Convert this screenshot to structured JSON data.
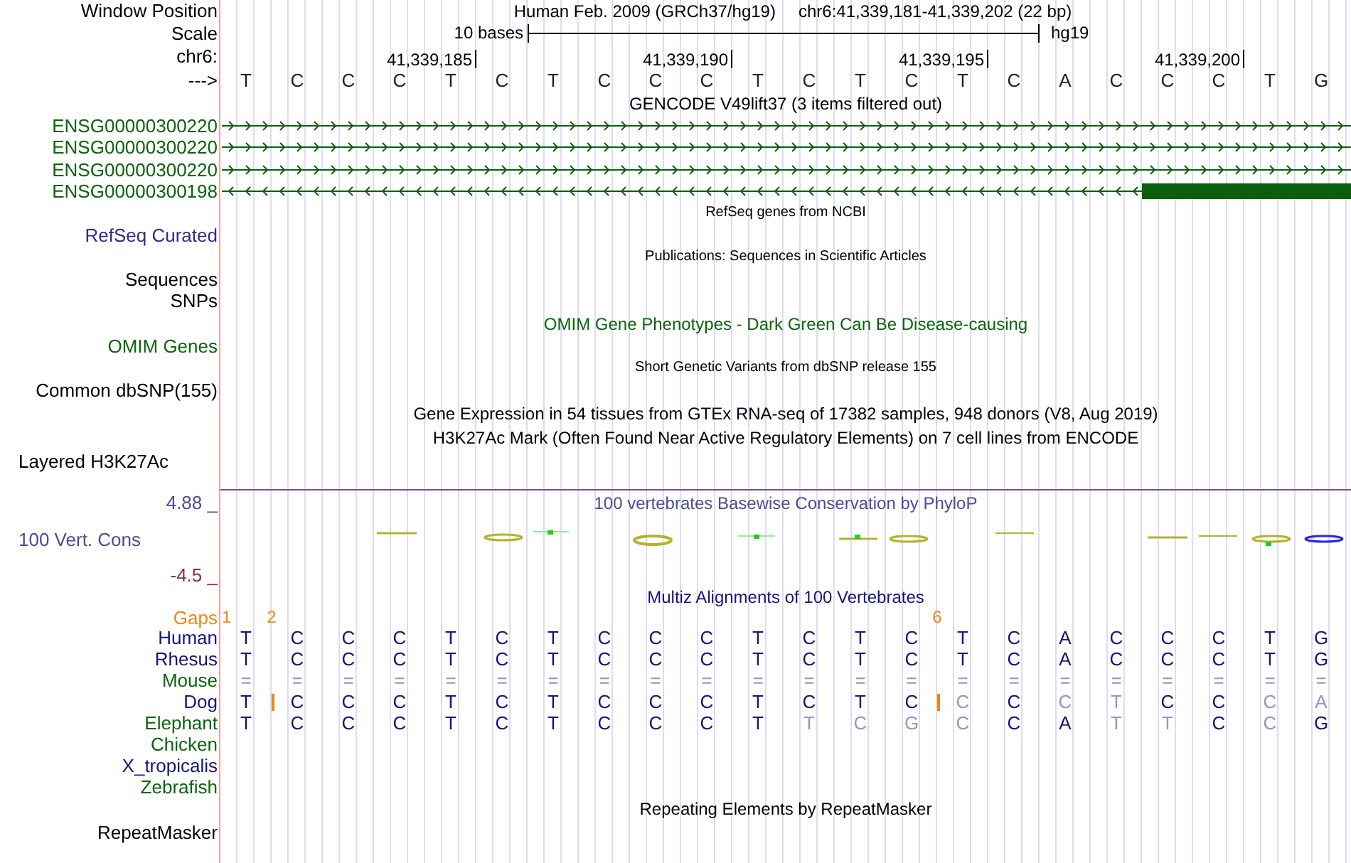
{
  "header": {
    "label": "Window Position",
    "assembly": "Human Feb. 2009 (GRCh37/hg19)",
    "range": "chr6:41,339,181-41,339,202 (22 bp)"
  },
  "scale": {
    "label": "Scale",
    "length": "10 bases",
    "assembly": "hg19"
  },
  "ruler_label": "chr6:",
  "strand_label": "--->",
  "sequence": [
    {
      "base": "T",
      "gap_mark": "1"
    },
    {
      "base": "C",
      "gap_mark": "2"
    },
    {
      "base": "C"
    },
    {
      "base": "C"
    },
    {
      "base": "T",
      "tick": "41,339,185"
    },
    {
      "base": "C"
    },
    {
      "base": "T"
    },
    {
      "base": "C"
    },
    {
      "base": "C"
    },
    {
      "base": "C",
      "tick": "41,339,190"
    },
    {
      "base": "T"
    },
    {
      "base": "C"
    },
    {
      "base": "T"
    },
    {
      "base": "C"
    },
    {
      "base": "T",
      "tick": "41,339,195",
      "gap_mark": "6"
    },
    {
      "base": "C"
    },
    {
      "base": "A"
    },
    {
      "base": "C"
    },
    {
      "base": "C"
    },
    {
      "base": "C",
      "tick": "41,339,200"
    },
    {
      "base": "T"
    },
    {
      "base": "G"
    }
  ],
  "gencode": {
    "title": "GENCODE V49lift37 (3 items filtered out)",
    "genes": [
      {
        "name": "ENSG00000300220",
        "reverse": false,
        "exon": false
      },
      {
        "name": "ENSG00000300220",
        "reverse": false,
        "exon": false
      },
      {
        "name": "ENSG00000300220",
        "reverse": false,
        "exon": false
      },
      {
        "name": "ENSG00000300198",
        "reverse": true,
        "exon": true
      }
    ]
  },
  "tracks": [
    {
      "kind": "small_title",
      "text": "RefSeq genes from NCBI",
      "color": "#000000"
    },
    {
      "kind": "label",
      "text": "RefSeq Curated",
      "color": "#2d2d8c"
    },
    {
      "kind": "small_title",
      "text": "Publications: Sequences in Scientific Articles",
      "color": "#000000"
    },
    {
      "kind": "label",
      "text": "Sequences",
      "color": "#000000"
    },
    {
      "kind": "label",
      "text": "SNPs",
      "color": "#000000"
    },
    {
      "kind": "title",
      "text": "OMIM Gene Phenotypes - Dark Green Can Be Disease-causing",
      "color": "#0a640a"
    },
    {
      "kind": "label",
      "text": "OMIM Genes",
      "color": "#0a640a"
    },
    {
      "kind": "small_title",
      "text": "Short Genetic Variants from dbSNP release 155",
      "color": "#000000"
    },
    {
      "kind": "label",
      "text": "Common dbSNP(155)",
      "color": "#000000"
    },
    {
      "kind": "title",
      "text": "Gene Expression in 54 tissues from GTEx RNA-seq of 17382 samples, 948 donors (V8, Aug 2019)",
      "color": "#000000"
    },
    {
      "kind": "title",
      "text": "H3K27Ac Mark (Often Found Near Active Regulatory Elements) on 7 cell lines from ENCODE",
      "color": "#000000"
    },
    {
      "kind": "left_label",
      "text": "Layered H3K27Ac",
      "color": "#000000"
    }
  ],
  "conservation": {
    "max": "4.88 _",
    "title": "100 vertebrates Basewise Conservation by PhyloP",
    "label": "100 Vert. Cons",
    "min": "-4.5 _"
  },
  "multiz": {
    "title": "Multiz Alignments of 100 Vertebrates",
    "gaps_label": "Gaps",
    "species": [
      {
        "name": "Human",
        "color": "#14147a",
        "cells": [
          {
            "text": "T",
            "faded": false,
            "gap_before": false
          },
          {
            "text": "C",
            "faded": false,
            "gap_before": false
          },
          {
            "text": "C",
            "faded": false,
            "gap_before": false
          },
          {
            "text": "C",
            "faded": false,
            "gap_before": false
          },
          {
            "text": "T",
            "faded": false,
            "gap_before": false
          },
          {
            "text": "C",
            "faded": false,
            "gap_before": false
          },
          {
            "text": "T",
            "faded": false,
            "gap_before": false
          },
          {
            "text": "C",
            "faded": false,
            "gap_before": false
          },
          {
            "text": "C",
            "faded": false,
            "gap_before": false
          },
          {
            "text": "C",
            "faded": false,
            "gap_before": false
          },
          {
            "text": "T",
            "faded": false,
            "gap_before": false
          },
          {
            "text": "C",
            "faded": false,
            "gap_before": false
          },
          {
            "text": "T",
            "faded": false,
            "gap_before": false
          },
          {
            "text": "C",
            "faded": false,
            "gap_before": false
          },
          {
            "text": "T",
            "faded": false,
            "gap_before": false
          },
          {
            "text": "C",
            "faded": false,
            "gap_before": false
          },
          {
            "text": "A",
            "faded": false,
            "gap_before": false
          },
          {
            "text": "C",
            "faded": false,
            "gap_before": false
          },
          {
            "text": "C",
            "faded": false,
            "gap_before": false
          },
          {
            "text": "C",
            "faded": false,
            "gap_before": false
          },
          {
            "text": "T",
            "faded": false,
            "gap_before": false
          },
          {
            "text": "G",
            "faded": false,
            "gap_before": false
          }
        ]
      },
      {
        "name": "Rhesus",
        "color": "#14147a",
        "cells": [
          {
            "text": "T",
            "faded": false,
            "gap_before": false
          },
          {
            "text": "C",
            "faded": false,
            "gap_before": false
          },
          {
            "text": "C",
            "faded": false,
            "gap_before": false
          },
          {
            "text": "C",
            "faded": false,
            "gap_before": false
          },
          {
            "text": "T",
            "faded": false,
            "gap_before": false
          },
          {
            "text": "C",
            "faded": false,
            "gap_before": false
          },
          {
            "text": "T",
            "faded": false,
            "gap_before": false
          },
          {
            "text": "C",
            "faded": false,
            "gap_before": false
          },
          {
            "text": "C",
            "faded": false,
            "gap_before": false
          },
          {
            "text": "C",
            "faded": false,
            "gap_before": false
          },
          {
            "text": "T",
            "faded": false,
            "gap_before": false
          },
          {
            "text": "C",
            "faded": false,
            "gap_before": false
          },
          {
            "text": "T",
            "faded": false,
            "gap_before": false
          },
          {
            "text": "C",
            "faded": false,
            "gap_before": false
          },
          {
            "text": "T",
            "faded": false,
            "gap_before": false
          },
          {
            "text": "C",
            "faded": false,
            "gap_before": false
          },
          {
            "text": "A",
            "faded": false,
            "gap_before": false
          },
          {
            "text": "C",
            "faded": false,
            "gap_before": false
          },
          {
            "text": "C",
            "faded": false,
            "gap_before": false
          },
          {
            "text": "C",
            "faded": false,
            "gap_before": false
          },
          {
            "text": "T",
            "faded": false,
            "gap_before": false
          },
          {
            "text": "G",
            "faded": false,
            "gap_before": false
          }
        ]
      },
      {
        "name": "Mouse",
        "color": "#0a640a",
        "cells": [
          {
            "text": "=",
            "faded": true,
            "gap_before": false
          },
          {
            "text": "=",
            "faded": true,
            "gap_before": false
          },
          {
            "text": "=",
            "faded": true,
            "gap_before": false
          },
          {
            "text": "=",
            "faded": true,
            "gap_before": false
          },
          {
            "text": "=",
            "faded": true,
            "gap_before": false
          },
          {
            "text": "=",
            "faded": true,
            "gap_before": false
          },
          {
            "text": "=",
            "faded": true,
            "gap_before": false
          },
          {
            "text": "=",
            "faded": true,
            "gap_before": false
          },
          {
            "text": "=",
            "faded": true,
            "gap_before": false
          },
          {
            "text": "=",
            "faded": true,
            "gap_before": false
          },
          {
            "text": "=",
            "faded": true,
            "gap_before": false
          },
          {
            "text": "=",
            "faded": true,
            "gap_before": false
          },
          {
            "text": "=",
            "faded": true,
            "gap_before": false
          },
          {
            "text": "=",
            "faded": true,
            "gap_before": false
          },
          {
            "text": "=",
            "faded": true,
            "gap_before": false
          },
          {
            "text": "=",
            "faded": true,
            "gap_before": false
          },
          {
            "text": "=",
            "faded": true,
            "gap_before": false
          },
          {
            "text": "=",
            "faded": true,
            "gap_before": false
          },
          {
            "text": "=",
            "faded": true,
            "gap_before": false
          },
          {
            "text": "=",
            "faded": true,
            "gap_before": false
          },
          {
            "text": "=",
            "faded": true,
            "gap_before": false
          },
          {
            "text": "=",
            "faded": true,
            "gap_before": false
          }
        ]
      },
      {
        "name": "Dog",
        "color": "#14147a",
        "cells": [
          {
            "text": "T",
            "faded": false,
            "gap_before": false
          },
          {
            "text": "C",
            "faded": false,
            "gap_before": true
          },
          {
            "text": "C",
            "faded": false,
            "gap_before": false
          },
          {
            "text": "C",
            "faded": false,
            "gap_before": false
          },
          {
            "text": "T",
            "faded": false,
            "gap_before": false
          },
          {
            "text": "C",
            "faded": false,
            "gap_before": false
          },
          {
            "text": "T",
            "faded": false,
            "gap_before": false
          },
          {
            "text": "C",
            "faded": false,
            "gap_before": false
          },
          {
            "text": "C",
            "faded": false,
            "gap_before": false
          },
          {
            "text": "C",
            "faded": false,
            "gap_before": false
          },
          {
            "text": "T",
            "faded": false,
            "gap_before": false
          },
          {
            "text": "C",
            "faded": false,
            "gap_before": false
          },
          {
            "text": "T",
            "faded": false,
            "gap_before": false
          },
          {
            "text": "C",
            "faded": false,
            "gap_before": false
          },
          {
            "text": "C",
            "faded": true,
            "gap_before": true
          },
          {
            "text": "C",
            "faded": false,
            "gap_before": false
          },
          {
            "text": "C",
            "faded": true,
            "gap_before": false
          },
          {
            "text": "T",
            "faded": true,
            "gap_before": false
          },
          {
            "text": "C",
            "faded": false,
            "gap_before": false
          },
          {
            "text": "C",
            "faded": false,
            "gap_before": false
          },
          {
            "text": "C",
            "faded": true,
            "gap_before": false
          },
          {
            "text": "A",
            "faded": true,
            "gap_before": false
          }
        ]
      },
      {
        "name": "Elephant",
        "color": "#0a640a",
        "cells": [
          {
            "text": "T",
            "faded": false,
            "gap_before": false
          },
          {
            "text": "C",
            "faded": false,
            "gap_before": false
          },
          {
            "text": "C",
            "faded": false,
            "gap_before": false
          },
          {
            "text": "C",
            "faded": false,
            "gap_before": false
          },
          {
            "text": "T",
            "faded": false,
            "gap_before": false
          },
          {
            "text": "C",
            "faded": false,
            "gap_before": false
          },
          {
            "text": "T",
            "faded": false,
            "gap_before": false
          },
          {
            "text": "C",
            "faded": false,
            "gap_before": false
          },
          {
            "text": "C",
            "faded": false,
            "gap_before": false
          },
          {
            "text": "C",
            "faded": false,
            "gap_before": false
          },
          {
            "text": "T",
            "faded": false,
            "gap_before": false
          },
          {
            "text": "T",
            "faded": true,
            "gap_before": false
          },
          {
            "text": "C",
            "faded": true,
            "gap_before": false
          },
          {
            "text": "G",
            "faded": true,
            "gap_before": false
          },
          {
            "text": "C",
            "faded": true,
            "gap_before": false
          },
          {
            "text": "C",
            "faded": false,
            "gap_before": false
          },
          {
            "text": "A",
            "faded": false,
            "gap_before": false
          },
          {
            "text": "T",
            "faded": true,
            "gap_before": false
          },
          {
            "text": "T",
            "faded": true,
            "gap_before": false
          },
          {
            "text": "C",
            "faded": false,
            "gap_before": false
          },
          {
            "text": "C",
            "faded": true,
            "gap_before": false
          },
          {
            "text": "G",
            "faded": false,
            "gap_before": false
          }
        ]
      },
      {
        "name": "Chicken",
        "color": "#0a640a"
      },
      {
        "name": "X_tropicalis",
        "color": "#14147a"
      },
      {
        "name": "Zebrafish",
        "color": "#0a640a"
      }
    ]
  },
  "repeatmasker": {
    "title": "Repeating Elements by RepeatMasker",
    "label": "RepeatMasker"
  }
}
